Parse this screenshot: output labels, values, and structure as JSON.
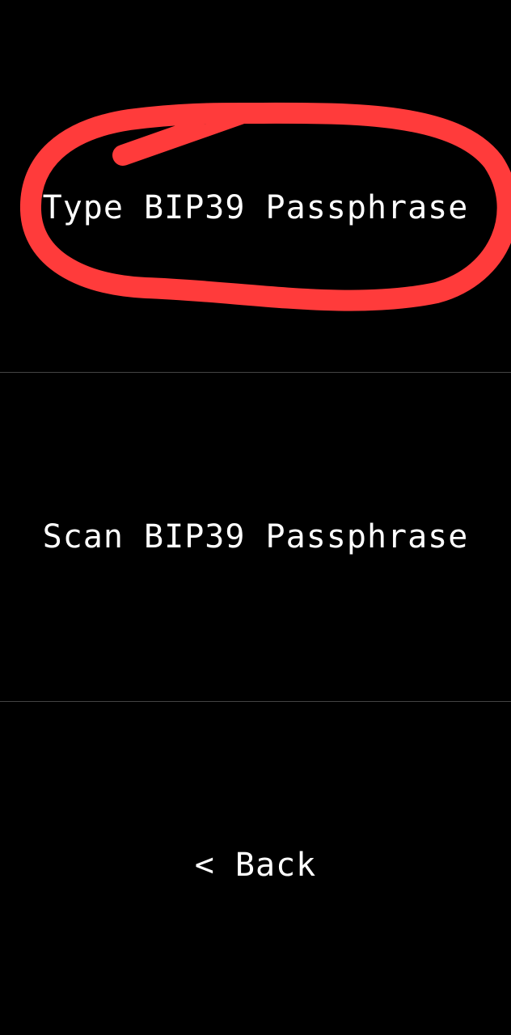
{
  "menu": {
    "items": [
      {
        "label": "Type BIP39 Passphrase"
      },
      {
        "label": "Scan BIP39 Passphrase"
      },
      {
        "label": "< Back"
      }
    ]
  },
  "annotation": {
    "color": "#ff3b3b",
    "target": "Type BIP39 Passphrase"
  }
}
